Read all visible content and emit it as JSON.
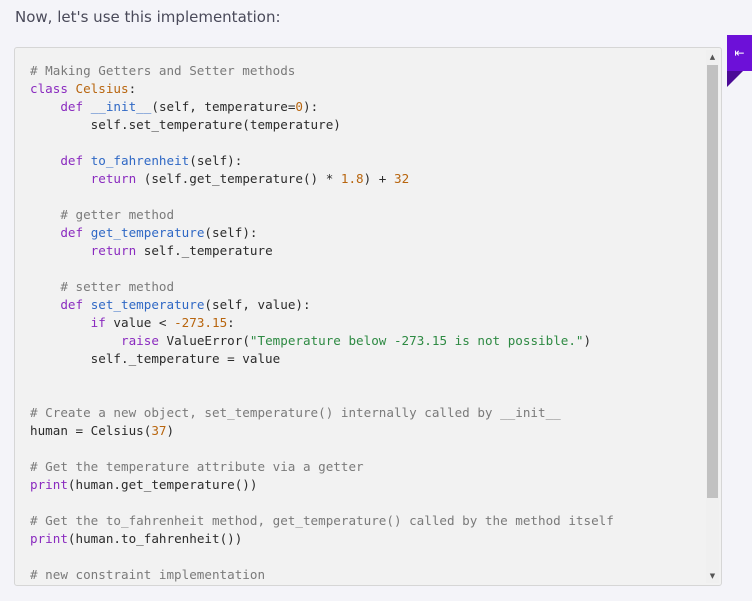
{
  "intro_text": "Now, let's use this implementation:",
  "side_tab_icon": "collapse-arrow-icon",
  "code_lines": [
    [
      {
        "t": "# Making Getters and Setter methods",
        "c": "c"
      }
    ],
    [
      {
        "t": "class ",
        "c": "k"
      },
      {
        "t": "Celsius",
        "c": "n"
      },
      {
        "t": ":",
        "c": ""
      }
    ],
    [
      {
        "t": "    ",
        "c": ""
      },
      {
        "t": "def ",
        "c": "k"
      },
      {
        "t": "__init__",
        "c": "f"
      },
      {
        "t": "(self, temperature=",
        "c": ""
      },
      {
        "t": "0",
        "c": "n"
      },
      {
        "t": "):",
        "c": ""
      }
    ],
    [
      {
        "t": "        self.set_temperature(temperature)",
        "c": ""
      }
    ],
    [],
    [
      {
        "t": "    ",
        "c": ""
      },
      {
        "t": "def ",
        "c": "k"
      },
      {
        "t": "to_fahrenheit",
        "c": "f"
      },
      {
        "t": "(self):",
        "c": ""
      }
    ],
    [
      {
        "t": "        ",
        "c": ""
      },
      {
        "t": "return ",
        "c": "k"
      },
      {
        "t": "(self.get_temperature() * ",
        "c": ""
      },
      {
        "t": "1.8",
        "c": "n"
      },
      {
        "t": ") + ",
        "c": ""
      },
      {
        "t": "32",
        "c": "n"
      }
    ],
    [],
    [
      {
        "t": "    # getter method",
        "c": "c"
      }
    ],
    [
      {
        "t": "    ",
        "c": ""
      },
      {
        "t": "def ",
        "c": "k"
      },
      {
        "t": "get_temperature",
        "c": "f"
      },
      {
        "t": "(self):",
        "c": ""
      }
    ],
    [
      {
        "t": "        ",
        "c": ""
      },
      {
        "t": "return ",
        "c": "k"
      },
      {
        "t": "self._temperature",
        "c": ""
      }
    ],
    [],
    [
      {
        "t": "    # setter method",
        "c": "c"
      }
    ],
    [
      {
        "t": "    ",
        "c": ""
      },
      {
        "t": "def ",
        "c": "k"
      },
      {
        "t": "set_temperature",
        "c": "f"
      },
      {
        "t": "(self, value):",
        "c": ""
      }
    ],
    [
      {
        "t": "        ",
        "c": ""
      },
      {
        "t": "if ",
        "c": "k"
      },
      {
        "t": "value < ",
        "c": ""
      },
      {
        "t": "-273.15",
        "c": "n"
      },
      {
        "t": ":",
        "c": ""
      }
    ],
    [
      {
        "t": "            ",
        "c": ""
      },
      {
        "t": "raise ",
        "c": "k"
      },
      {
        "t": "ValueError(",
        "c": ""
      },
      {
        "t": "\"Temperature below -273.15 is not possible.\"",
        "c": "s"
      },
      {
        "t": ")",
        "c": ""
      }
    ],
    [
      {
        "t": "        self._temperature = value",
        "c": ""
      }
    ],
    [],
    [],
    [
      {
        "t": "# Create a new object, set_temperature() internally called by __init__",
        "c": "c"
      }
    ],
    [
      {
        "t": "human = Celsius(",
        "c": ""
      },
      {
        "t": "37",
        "c": "n"
      },
      {
        "t": ")",
        "c": ""
      }
    ],
    [],
    [
      {
        "t": "# Get the temperature attribute via a getter",
        "c": "c"
      }
    ],
    [
      {
        "t": "print",
        "c": "k"
      },
      {
        "t": "(human.get_temperature())",
        "c": ""
      }
    ],
    [],
    [
      {
        "t": "# Get the to_fahrenheit method, get_temperature() called by the method itself",
        "c": "c"
      }
    ],
    [
      {
        "t": "print",
        "c": "k"
      },
      {
        "t": "(human.to_fahrenheit())",
        "c": ""
      }
    ],
    [],
    [
      {
        "t": "# new constraint implementation",
        "c": "c"
      }
    ]
  ]
}
